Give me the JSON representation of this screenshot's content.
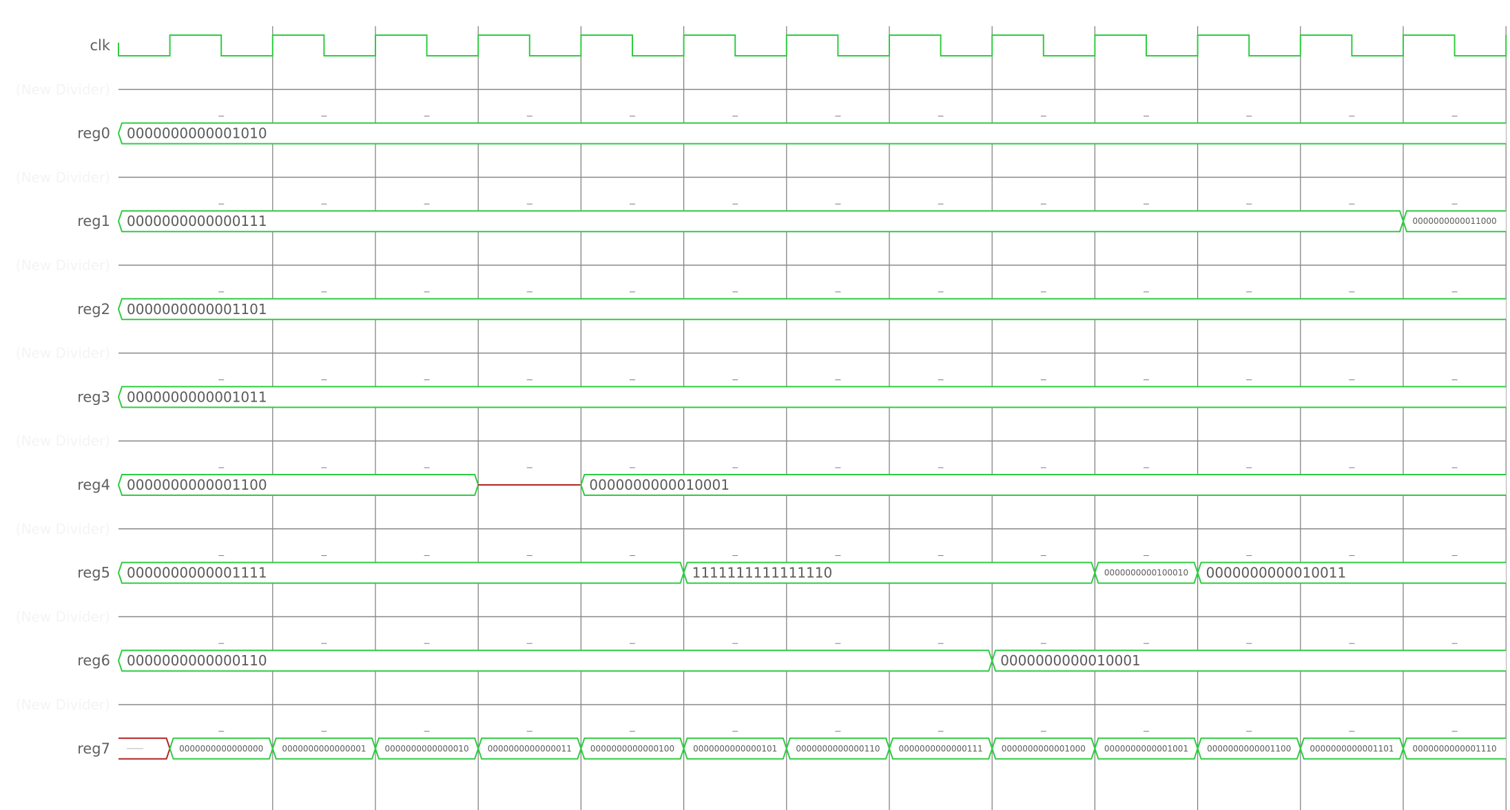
{
  "colors": {
    "signal_green": "#2ecc40",
    "undefined_red": "#b22222",
    "grid_gray": "#7a7a7a",
    "divider_gray": "#888888",
    "label_gray": "#5f5f5f",
    "divider_label": "#f2f2f2"
  },
  "time": {
    "clock_periods": 13.5,
    "first_rise": 0.5
  },
  "signals": [
    {
      "name": "clk",
      "kind": "clock"
    },
    {
      "name": "(New Divider)",
      "kind": "divider"
    },
    {
      "name": "reg0",
      "kind": "bus",
      "segments": [
        {
          "start": 0,
          "end": 13.5,
          "value": "0000000000001010"
        }
      ]
    },
    {
      "name": "(New Divider)",
      "kind": "divider"
    },
    {
      "name": "reg1",
      "kind": "bus",
      "segments": [
        {
          "start": 0,
          "end": 12.5,
          "value": "0000000000000111"
        },
        {
          "start": 12.5,
          "end": 13.5,
          "value": "0000000000011000"
        }
      ]
    },
    {
      "name": "(New Divider)",
      "kind": "divider"
    },
    {
      "name": "reg2",
      "kind": "bus",
      "segments": [
        {
          "start": 0,
          "end": 13.5,
          "value": "0000000000001101"
        }
      ]
    },
    {
      "name": "(New Divider)",
      "kind": "divider"
    },
    {
      "name": "reg3",
      "kind": "bus",
      "segments": [
        {
          "start": 0,
          "end": 13.5,
          "value": "0000000000001011"
        }
      ]
    },
    {
      "name": "(New Divider)",
      "kind": "divider"
    },
    {
      "name": "reg4",
      "kind": "bus",
      "segments": [
        {
          "start": 0,
          "end": 3.5,
          "value": "0000000000001100"
        },
        {
          "start": 3.5,
          "end": 4.5,
          "value": "",
          "state": "highz"
        },
        {
          "start": 4.5,
          "end": 13.5,
          "value": "0000000000010001"
        }
      ]
    },
    {
      "name": "(New Divider)",
      "kind": "divider"
    },
    {
      "name": "reg5",
      "kind": "bus",
      "segments": [
        {
          "start": 0,
          "end": 5.5,
          "value": "0000000000001111"
        },
        {
          "start": 5.5,
          "end": 9.5,
          "value": "1111111111111110"
        },
        {
          "start": 9.5,
          "end": 10.5,
          "value": "0000000000100010"
        },
        {
          "start": 10.5,
          "end": 13.5,
          "value": "0000000000010011"
        }
      ]
    },
    {
      "name": "(New Divider)",
      "kind": "divider"
    },
    {
      "name": "reg6",
      "kind": "bus",
      "segments": [
        {
          "start": 0,
          "end": 8.5,
          "value": "0000000000000110"
        },
        {
          "start": 8.5,
          "end": 13.5,
          "value": "0000000000010001"
        }
      ]
    },
    {
      "name": "(New Divider)",
      "kind": "divider"
    },
    {
      "name": "reg7",
      "kind": "bus",
      "segments": [
        {
          "start": 0,
          "end": 0.5,
          "value": "",
          "state": "unknown"
        },
        {
          "start": 0.5,
          "end": 1.5,
          "value": "0000000000000000"
        },
        {
          "start": 1.5,
          "end": 2.5,
          "value": "0000000000000001"
        },
        {
          "start": 2.5,
          "end": 3.5,
          "value": "0000000000000010"
        },
        {
          "start": 3.5,
          "end": 4.5,
          "value": "0000000000000011"
        },
        {
          "start": 4.5,
          "end": 5.5,
          "value": "0000000000000100"
        },
        {
          "start": 5.5,
          "end": 6.5,
          "value": "0000000000000101"
        },
        {
          "start": 6.5,
          "end": 7.5,
          "value": "0000000000000110"
        },
        {
          "start": 7.5,
          "end": 8.5,
          "value": "0000000000000111"
        },
        {
          "start": 8.5,
          "end": 9.5,
          "value": "0000000000001000"
        },
        {
          "start": 9.5,
          "end": 10.5,
          "value": "0000000000001001"
        },
        {
          "start": 10.5,
          "end": 11.5,
          "value": "0000000000001100"
        },
        {
          "start": 11.5,
          "end": 12.5,
          "value": "0000000000001101"
        },
        {
          "start": 12.5,
          "end": 13.5,
          "value": "0000000000001110"
        }
      ]
    }
  ]
}
